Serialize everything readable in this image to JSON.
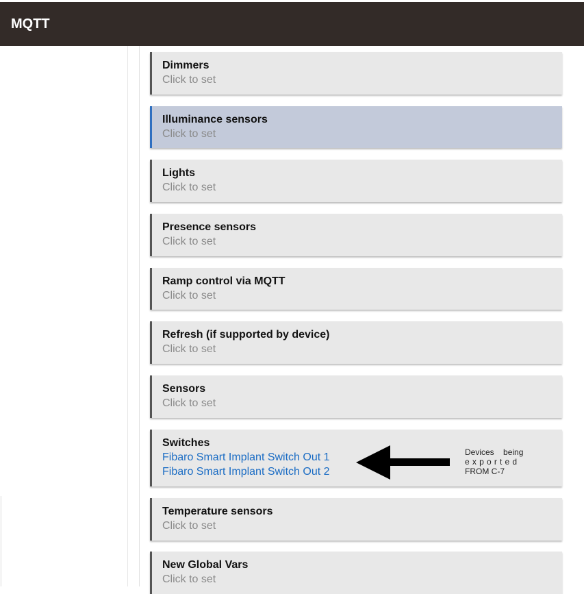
{
  "header": {
    "title": "MQTT"
  },
  "cards": [
    {
      "name": "Dimmers",
      "value": "Click to set"
    },
    {
      "name": "Illuminance sensors",
      "value": "Click to set"
    },
    {
      "name": "Lights",
      "value": "Click to set"
    },
    {
      "name": "Presence sensors",
      "value": "Click to set"
    },
    {
      "name": "Ramp control via MQTT",
      "value": "Click to set"
    },
    {
      "name": "Refresh (if supported by device)",
      "value": "Click to set"
    },
    {
      "name": "Sensors",
      "value": "Click to set"
    },
    {
      "name": "Switches",
      "devices": [
        "Fibaro Smart Implant Switch Out 1",
        "Fibaro Smart Implant Switch Out 2"
      ]
    },
    {
      "name": "Temperature sensors",
      "value": "Click to set"
    },
    {
      "name": "New Global Vars",
      "value": "Click to set"
    }
  ],
  "annotation": {
    "line1": "Devices being",
    "line2": "exported",
    "line3": "FROM C-7"
  },
  "colors": {
    "header_bg": "#332b28",
    "card_bg": "#e8e8e8",
    "selected_card_bg": "#c3cada",
    "link": "#1a6cc4"
  },
  "icons": {
    "annotation_arrow": "left-arrow-icon"
  }
}
